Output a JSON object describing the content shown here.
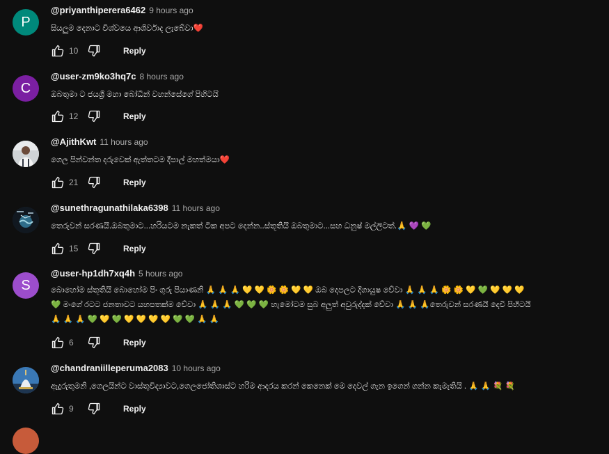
{
  "comments": [
    {
      "author": "@priyanthiperera6462",
      "time": "9 hours ago",
      "avatar_letter": "P",
      "avatar_color": "#00897b",
      "text": "සියලුම දෙනාට විශ්වයෙ ආශිර්වාද ලැබේවා❤️",
      "likes": "10",
      "reply_label": "Reply"
    },
    {
      "author": "@user-zm9ko3hq7c",
      "time": "8 hours ago",
      "avatar_letter": "C",
      "avatar_color": "#7b1fa2",
      "text": "ඔබතුමා ට ජයශ්‍රී මහා බෝධීන් වහන්සේගේ පිහිටයි",
      "likes": "12",
      "reply_label": "Reply"
    },
    {
      "author": "@AjithKwt",
      "time": "11 hours ago",
      "avatar_letter": "",
      "avatar_color": "#d9d9d9",
      "text": "ගෙල පින්වන්ත දරුවෙක් ඇත්තටම දීපාල් මහත්මයා❤️",
      "likes": "21",
      "reply_label": "Reply"
    },
    {
      "author": "@sunethragunathilaka6398",
      "time": "11 hours ago",
      "avatar_letter": "",
      "avatar_color": "#1b2a3a",
      "text": "තෙරුවන් සරණයි.ඔබතුමාට...හරියටම නැකත් ටික අපට දෙන්න..ස්තූතියි ඔබතුමාට...සහ ධනුෂ් මල්ලිටත්.🙏 💜 💚",
      "likes": "15",
      "reply_label": "Reply"
    },
    {
      "author": "@user-hp1dh7xq4h",
      "time": "5 hours ago",
      "avatar_letter": "S",
      "avatar_color": "#9c4dcc",
      "text": "බොහෝම ස්තූතියි බොහෝම පිං ගුරු පියාණනි 🙏 🙏 🙏 💛 💛 🌼 🌼 💛 💛 ඔබ දෙපලට දිගායුෂ වේවා 🙏 🙏 🙏 🌼 🌼 💛 💚 💛 💛 💛\n💚 මංගේ රටට ජනතාවට යහපතක්ම වේවා 🙏 🙏 🙏 💚 💚 💚 හැමෝටම සුබ අලුත් අවුරුද්දක් වේවා 🙏 🙏 🙏තෙරුවන් සරණයි දෙවි පිහිටයි\n🙏 🙏 🙏 💚 💛 💚 💛 💛 💛 💛 💚 💚 🙏 🙏",
      "likes": "6",
      "reply_label": "Reply"
    },
    {
      "author": "@chandraniilleperuma2083",
      "time": "10 hours ago",
      "avatar_letter": "",
      "avatar_color": "#2b5a8a",
      "text": "ඇදුරුතුමනි ,ගෙලයින්ට වාස්තුවිද්‍යාවට,ගෙලජෝතිශාස්ට හරිම ආදරය කරන් කෙනෙක් මෙ දෙවල් ගැන ඉගෙන් ගන්න කැමැතියි . 🙏 🙏 💐 💐",
      "likes": "9",
      "reply_label": "Reply"
    }
  ],
  "icons": {
    "like": "thumbs-up-icon",
    "dislike": "thumbs-down-icon"
  }
}
